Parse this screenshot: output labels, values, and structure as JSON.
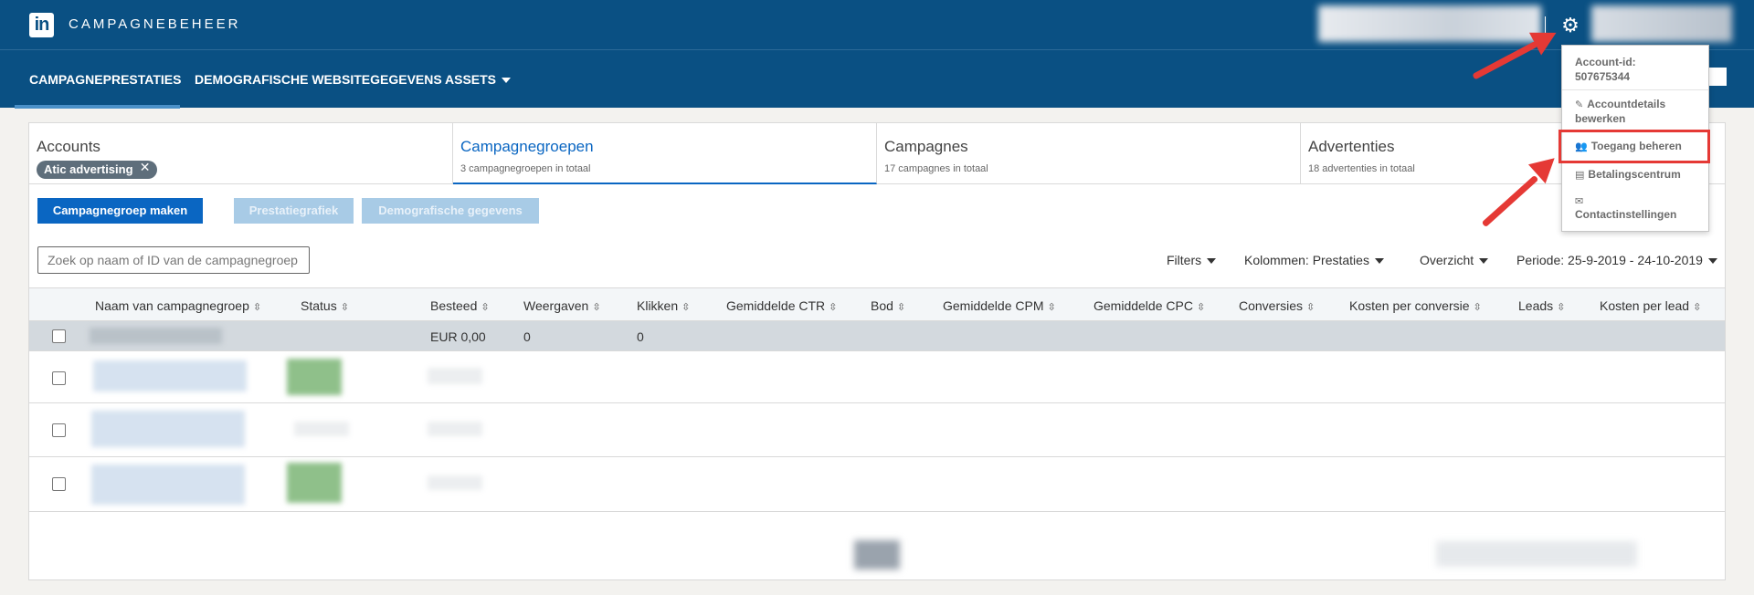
{
  "topbar": {
    "logo": "in",
    "title": "CAMPAGNEBEHEER",
    "settings_icon": "gear-icon"
  },
  "nav": {
    "items": [
      "CAMPAGNEPRESTATIES",
      "DEMOGRAFISCHE WEBSITEGEGEVENS",
      "ASSETS"
    ],
    "active": "CAMPAGNEPRESTATIES"
  },
  "tabs": [
    {
      "title": "Accounts",
      "filter": "Atic advertising"
    },
    {
      "title": "Campagnegroepen",
      "subtitle": "3 campagnegroepen in totaal"
    },
    {
      "title": "Campagnes",
      "subtitle": "17 campagnes in totaal"
    },
    {
      "title": "Advertenties",
      "subtitle": "18 advertenties in totaal"
    }
  ],
  "buttons": {
    "create": "Campagnegroep maken",
    "chart": "Prestatiegrafiek",
    "demographics": "Demografische gegevens"
  },
  "search": {
    "placeholder": "Zoek op naam of ID van de campagnegroep"
  },
  "controls": {
    "filters": "Filters",
    "columns_label": "Kolommen:",
    "columns_value": "Prestaties",
    "overview": "Overzicht",
    "period_label": "Periode:",
    "period_value": "25-9-2019 - 24-10-2019"
  },
  "table": {
    "headers": [
      "Naam van campagnegroep",
      "Status",
      "Besteed",
      "Weergaven",
      "Klikken",
      "Gemiddelde CTR",
      "Bod",
      "Gemiddelde CPM",
      "Gemiddelde CPC",
      "Conversies",
      "Kosten per conversie",
      "Leads",
      "Kosten per lead"
    ],
    "total_row": {
      "spent": "EUR 0,00",
      "impressions": "0",
      "clicks": "0"
    }
  },
  "dropdown": {
    "account_id_label": "Account-id:",
    "account_id": "507675344",
    "items": [
      "Accountdetails bewerken",
      "Toegang beheren",
      "Betalingscentrum",
      "Contactinstellingen"
    ]
  },
  "colors": {
    "brand": "#0a5083",
    "accent": "#0a66c2",
    "annotation": "#e53935"
  }
}
